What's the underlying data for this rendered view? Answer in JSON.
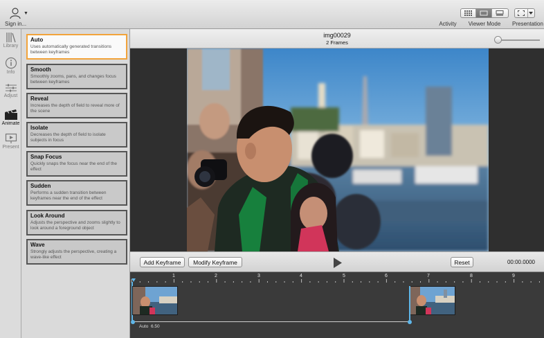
{
  "toolbar": {
    "signin_label": "Sign in...",
    "activity_label": "Activity",
    "viewer_mode_label": "Viewer Mode",
    "presentation_label": "Presentation"
  },
  "rail": {
    "library": "Library",
    "info": "Info",
    "adjust": "Adjust",
    "animate": "Animate",
    "present": "Present"
  },
  "effects": [
    {
      "name": "Auto",
      "desc": "Uses automatically generated transitions between keyframes",
      "selected": true
    },
    {
      "name": "Smooth",
      "desc": "Smoothly zooms, pans, and changes focus between keyframes"
    },
    {
      "name": "Reveal",
      "desc": "Increases the depth of field to reveal more of the scene"
    },
    {
      "name": "Isolate",
      "desc": "Decreases the depth of field to isolate subjects in focus"
    },
    {
      "name": "Snap Focus",
      "desc": "Quickly snaps the focus near the end of the effect"
    },
    {
      "name": "Sudden",
      "desc": "Performs a sudden transition between keyframes near the end of the effect"
    },
    {
      "name": "Look Around",
      "desc": "Adjusts the perspective and zooms slightly to look around a foreground object"
    },
    {
      "name": "Wave",
      "desc": "Strongly adjusts the perspective, creating a wave-like effect"
    }
  ],
  "viewer": {
    "title": "img00029",
    "subtitle": "2 Frames"
  },
  "controls": {
    "add_keyframe": "Add Keyframe",
    "modify_keyframe": "Modify Keyframe",
    "reset": "Reset",
    "timecode": "00:00.0000"
  },
  "timeline": {
    "ruler": [
      "1",
      "2",
      "3",
      "4",
      "5",
      "6",
      "7",
      "8",
      "9"
    ],
    "segment_label": "Auto",
    "segment_duration": "6.50"
  },
  "colors": {
    "selection": "#f2a33a",
    "keyframe": "#5fb6e8"
  }
}
